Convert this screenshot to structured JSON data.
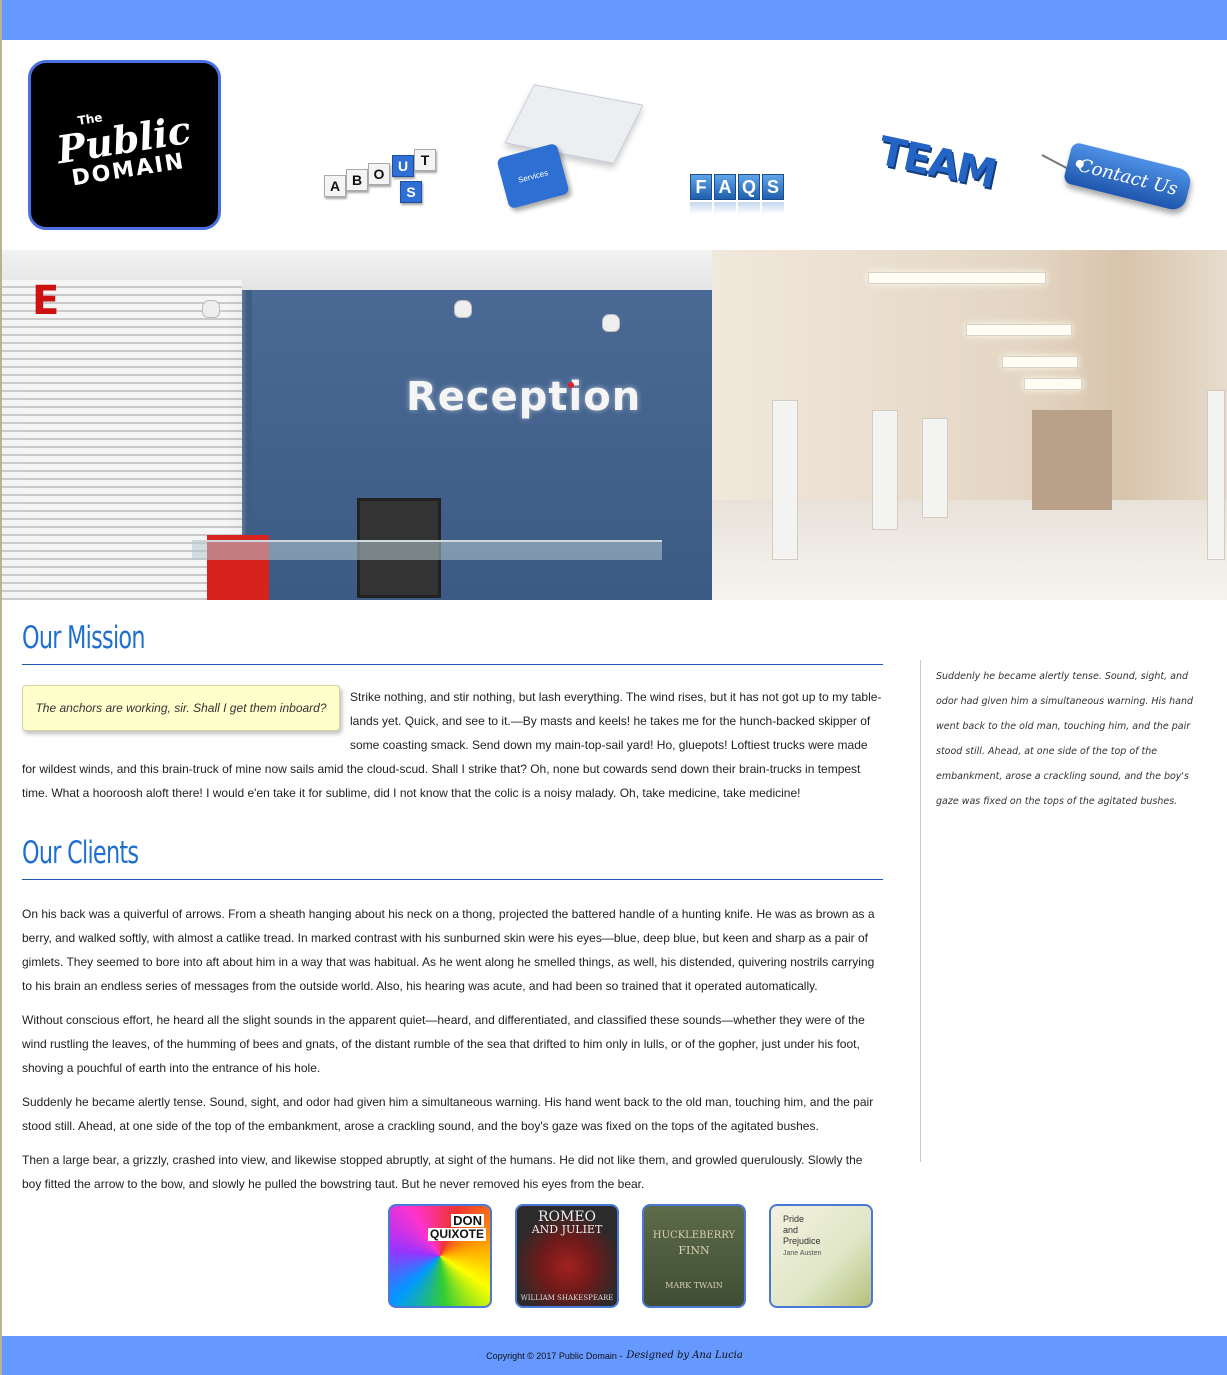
{
  "brand": {
    "logo_the": "The",
    "logo_public": "Public",
    "logo_domain": "DOMAIN"
  },
  "nav": {
    "about_letters": [
      "A",
      "B",
      "O",
      "U",
      "T"
    ],
    "about_us_letters": [
      "U",
      "S"
    ],
    "services_label": "Services",
    "faqs_letters": [
      "F",
      "A",
      "Q",
      "S"
    ],
    "team_label": "TEAM",
    "contact_label": "Contact Us"
  },
  "hero": {
    "sign_text": "Reception",
    "corner_letter": "E"
  },
  "mission": {
    "title": "Our Mission",
    "pullquote": "The anchors are working, sir. Shall I get them inboard?",
    "text": "Strike nothing, and stir nothing, but lash everything. The wind rises, but it has not got up to my table-lands yet. Quick, and see to it.—By masts and keels! he takes me for the hunch-backed skipper of some coasting smack. Send down my main-top-sail yard! Ho, gluepots! Loftiest trucks were made for wildest winds, and this brain-truck of mine now sails amid the cloud-scud. Shall I strike that? Oh, none but cowards send down their brain-trucks in tempest time. What a hooroosh aloft there! I would e'en take it for sublime, did I not know that the colic is a noisy malady. Oh, take medicine, take medicine!"
  },
  "clients": {
    "title": "Our Clients",
    "paragraphs": [
      "On his back was a quiverful of arrows. From a sheath hanging about his neck on a thong, projected the battered handle of a hunting knife. He was as brown as a berry, and walked softly, with almost a catlike tread. In marked contrast with his sunburned skin were his eyes—blue, deep blue, but keen and sharp as a pair of gimlets. They seemed to bore into aft about him in a way that was habitual. As he went along he smelled things, as well, his distended, quivering nostrils carrying to his brain an endless series of messages from the outside world. Also, his hearing was acute, and had been so trained that it operated automatically.",
      "Without conscious effort, he heard all the slight sounds in the apparent quiet—heard, and differentiated, and classified these sounds—whether they were of the wind rustling the leaves, of the humming of bees and gnats, of the distant rumble of the sea that drifted to him only in lulls, or of the gopher, just under his foot, shoving a pouchful of earth into the entrance of his hole.",
      "Suddenly he became alertly tense. Sound, sight, and odor had given him a simultaneous warning. His hand went back to the old man, touching him, and the pair stood still. Ahead, at one side of the top of the embankment, arose a crackling sound, and the boy's gaze was fixed on the tops of the agitated bushes.",
      "Then a large bear, a grizzly, crashed into view, and likewise stopped abruptly, at sight of the humans. He did not like them, and growled querulously. Slowly the boy fitted the arrow to the bow, and slowly he pulled the bowstring taut. But he never removed his eyes from the bear."
    ]
  },
  "sidebar": {
    "text": "Suddenly he became alertly tense. Sound, sight, and odor had given him a simultaneous warning. His hand went back to the old man, touching him, and the pair stood still. Ahead, at one side of the top of the embankment, arose a crackling sound, and the boy's gaze was fixed on the tops of the agitated bushes."
  },
  "books": [
    {
      "line1": "DON",
      "line2": "QUIXOTE"
    },
    {
      "line1": "ROMEO",
      "line2": "AND JULIET",
      "author": "WILLIAM SHAKESPEARE"
    },
    {
      "line1": "HUCKLEBERRY",
      "line2": "FINN",
      "author": "MARK TWAIN"
    },
    {
      "line1": "Pride",
      "line2": "and",
      "line3": "Prejudice",
      "author": "Jane Austen"
    }
  ],
  "footer": {
    "copyright": "Copyright © 2017 Public Domain -",
    "designed_by": "Designed by Ana Lucia"
  },
  "colors": {
    "bar_blue": "#6699ff",
    "heading_blue": "#1f6fd0",
    "note_yellow": "#ffffcc"
  }
}
